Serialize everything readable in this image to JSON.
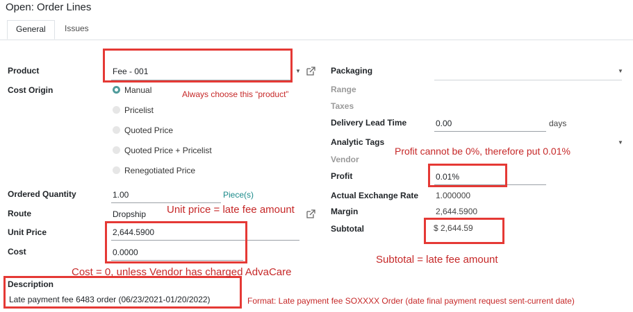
{
  "dialog": {
    "title": "Open: Order Lines"
  },
  "tabs": [
    {
      "label": "General"
    },
    {
      "label": "Issues"
    }
  ],
  "left": {
    "product": {
      "label": "Product",
      "value": "Fee - 001"
    },
    "cost_origin": {
      "label": "Cost Origin",
      "options": [
        "Manual",
        "Pricelist",
        "Quoted Price",
        "Quoted Price + Pricelist",
        "Renegotiated Price"
      ],
      "selected": "Manual"
    },
    "ordered_quantity": {
      "label": "Ordered Quantity",
      "value": "1.00",
      "uom": "Piece(s)"
    },
    "route": {
      "label": "Route",
      "value": "Dropship"
    },
    "unit_price": {
      "label": "Unit Price",
      "value": "2,644.5900"
    },
    "cost": {
      "label": "Cost",
      "value": "0.0000"
    },
    "description": {
      "label": "Description",
      "value": "Late payment fee 6483 order (06/23/2021-01/20/2022)"
    }
  },
  "right": {
    "packaging": {
      "label": "Packaging",
      "value": ""
    },
    "range": {
      "label": "Range"
    },
    "taxes": {
      "label": "Taxes"
    },
    "delivery_lead_time": {
      "label": "Delivery Lead Time",
      "value": "0.00",
      "unit": "days"
    },
    "analytic_tags": {
      "label": "Analytic Tags",
      "value": ""
    },
    "vendor": {
      "label": "Vendor"
    },
    "profit": {
      "label": "Profit",
      "value": "0.01%"
    },
    "actual_exchange_rate": {
      "label": "Actual Exchange Rate",
      "value": "1.000000"
    },
    "margin": {
      "label": "Margin",
      "value": "2,644.5900"
    },
    "subtotal": {
      "label": "Subtotal",
      "value": "$ 2,644.59"
    }
  },
  "annotations": {
    "product_note": "Always choose this “product”",
    "profit_note": "Profit cannot be 0%, therefore put 0.01%",
    "unit_price_note": "Unit price = late fee amount",
    "subtotal_note": "Subtotal = late fee amount",
    "cost_note": "Cost = 0, unless Vendor has charged AdvaCare",
    "format_note": "Format: Late payment fee SOXXXX Order (date final payment request sent-current date)"
  },
  "colors": {
    "annotation_red": "#e53935",
    "radio_teal": "#4f9b9b",
    "uom_teal": "#1a8a8a"
  }
}
